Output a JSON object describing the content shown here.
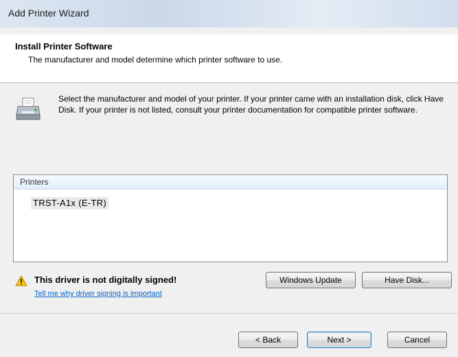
{
  "window": {
    "title": "Add Printer Wizard"
  },
  "header": {
    "title": "Install Printer Software",
    "subtitle": "The manufacturer and model determine which printer software to use."
  },
  "intro": {
    "icon": "printer-icon",
    "text": "Select the manufacturer and model of your printer. If your printer came with an installation disk, click Have Disk. If your printer is not listed, consult your printer documentation for compatible printer software."
  },
  "printers_list": {
    "header": "Printers",
    "items": [
      "TRST-A1x (E-TR)"
    ]
  },
  "warning": {
    "icon": "warning-icon",
    "text": "This driver is not digitally signed!",
    "link": "Tell me why driver signing is important"
  },
  "buttons": {
    "windows_update": "Windows Update",
    "have_disk": "Have Disk...",
    "back": "< Back",
    "next": "Next >",
    "cancel": "Cancel"
  }
}
